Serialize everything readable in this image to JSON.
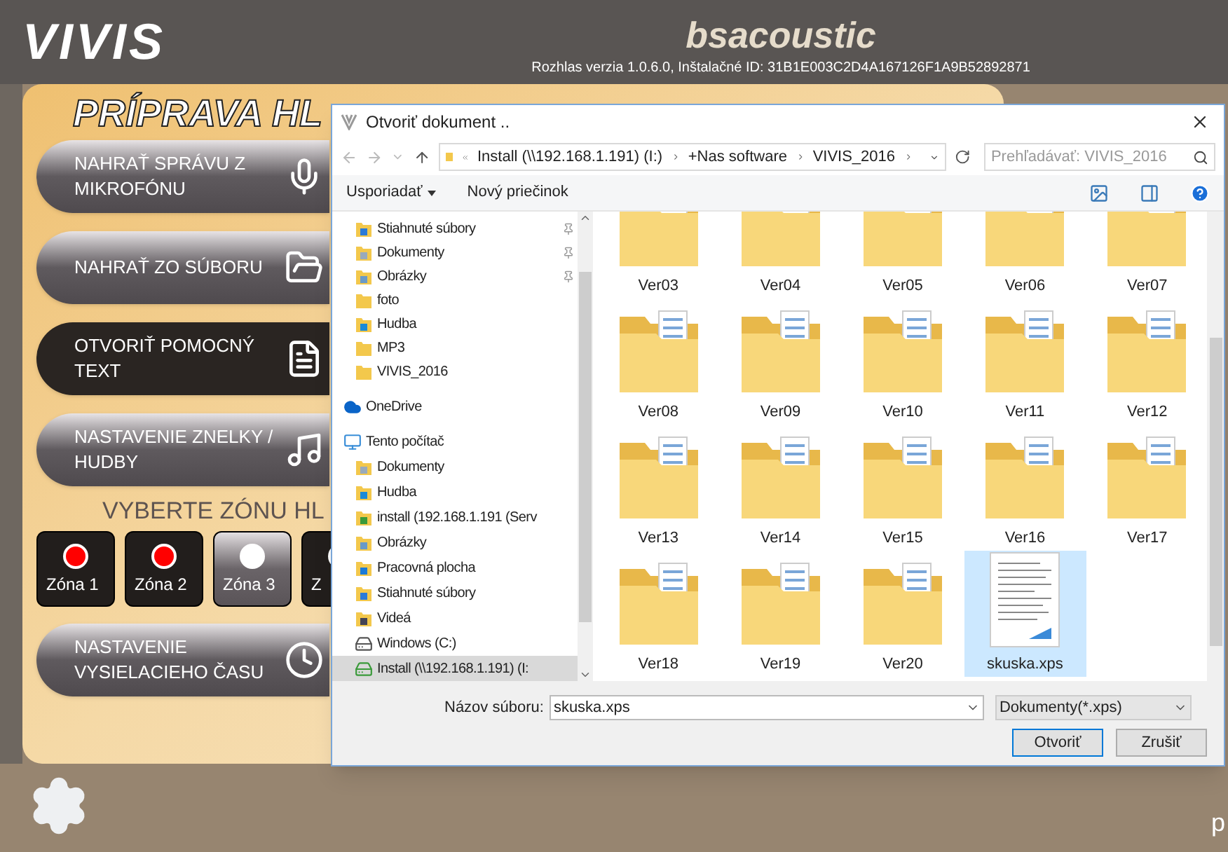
{
  "header": {
    "logo": "VIVIS",
    "brand": "bsacoustic",
    "version": "Rozhlas verzia 1.0.6.0, Inštalačné ID: 31B1E003C2D4A167126F1A9B52892871"
  },
  "panel": {
    "title": "PRÍPRAVA HL",
    "actions": [
      {
        "label": "NAHRAŤ SPRÁVU Z MIKROFÓNU",
        "kind": "mic",
        "selected": false
      },
      {
        "label": "NAHRAŤ ZO SÚBORU",
        "kind": "folder-music",
        "selected": false
      },
      {
        "label": "OTVORIŤ POMOCNÝ TEXT",
        "kind": "text",
        "selected": true
      },
      {
        "label": "NASTAVENIE ZNELKY / HUDBY",
        "kind": "music",
        "selected": false
      }
    ],
    "zone_heading": "VYBERTE ZÓNU HL",
    "zones": [
      {
        "label": "Zóna 1",
        "selected": false
      },
      {
        "label": "Zóna 2",
        "selected": false
      },
      {
        "label": "Zóna 3",
        "selected": true
      },
      {
        "label": "Z",
        "selected": false
      }
    ],
    "time_button": {
      "label": "NASTAVENIE VYSIELACIEHO ČASU",
      "kind": "clock",
      "selected": false
    }
  },
  "corner_text": "p",
  "dialog": {
    "title": "Otvoriť dokument ..",
    "path": [
      "Install (\\\\192.168.1.191) (I:)",
      "+Nas software",
      "VIVIS_2016"
    ],
    "search": {
      "placeholder": "Prehľadávať: VIVIS_2016"
    },
    "commands": [
      "Usporiadať",
      "Nový priečinok"
    ],
    "quick_access": [
      {
        "label": "Stiahnuté súbory",
        "kind": "download",
        "pinned": true
      },
      {
        "label": "Dokumenty",
        "kind": "document",
        "pinned": true
      },
      {
        "label": "Obrázky",
        "kind": "pictures",
        "pinned": true
      },
      {
        "label": "foto",
        "kind": "folder",
        "pinned": false
      },
      {
        "label": "Hudba",
        "kind": "music",
        "pinned": false
      },
      {
        "label": "MP3",
        "kind": "folder",
        "pinned": false
      },
      {
        "label": "VIVIS_2016",
        "kind": "folder",
        "pinned": false
      }
    ],
    "locations": [
      {
        "label": "OneDrive",
        "kind": "cloud",
        "selected": false
      },
      {
        "label": "Tento počítač",
        "kind": "computer",
        "selected": false,
        "children": [
          {
            "label": "Dokumenty",
            "kind": "document",
            "selected": false
          },
          {
            "label": "Hudba",
            "kind": "music",
            "selected": false
          },
          {
            "label": "install (192.168.1.191 (Serv",
            "kind": "network",
            "selected": false
          },
          {
            "label": "Obrázky",
            "kind": "pictures",
            "selected": false
          },
          {
            "label": "Pracovná plocha",
            "kind": "desktop",
            "selected": false
          },
          {
            "label": "Stiahnuté súbory",
            "kind": "download",
            "selected": false
          },
          {
            "label": "Videá",
            "kind": "video",
            "selected": false
          },
          {
            "label": "Windows (C:)",
            "kind": "drive",
            "selected": false
          },
          {
            "label": "Install (\\\\192.168.1.191) (I:",
            "kind": "netdrive",
            "selected": true
          }
        ]
      }
    ],
    "files": [
      {
        "name": "Ver03",
        "kind": "folder",
        "selected": false
      },
      {
        "name": "Ver04",
        "kind": "folder",
        "selected": false
      },
      {
        "name": "Ver05",
        "kind": "folder",
        "selected": false
      },
      {
        "name": "Ver06",
        "kind": "folder",
        "selected": false
      },
      {
        "name": "Ver07",
        "kind": "folder",
        "selected": false
      },
      {
        "name": "Ver08",
        "kind": "folder",
        "selected": false
      },
      {
        "name": "Ver09",
        "kind": "folder",
        "selected": false
      },
      {
        "name": "Ver10",
        "kind": "folder",
        "selected": false
      },
      {
        "name": "Ver11",
        "kind": "folder",
        "selected": false
      },
      {
        "name": "Ver12",
        "kind": "folder",
        "selected": false
      },
      {
        "name": "Ver13",
        "kind": "folder",
        "selected": false
      },
      {
        "name": "Ver14",
        "kind": "folder",
        "selected": false
      },
      {
        "name": "Ver15",
        "kind": "folder",
        "selected": false
      },
      {
        "name": "Ver16",
        "kind": "folder",
        "selected": false
      },
      {
        "name": "Ver17",
        "kind": "folder",
        "selected": false
      },
      {
        "name": "Ver18",
        "kind": "folder",
        "selected": false
      },
      {
        "name": "Ver19",
        "kind": "folder",
        "selected": false
      },
      {
        "name": "Ver20",
        "kind": "folder",
        "selected": false
      },
      {
        "name": "skuska.xps",
        "kind": "document",
        "selected": true
      }
    ],
    "filename_label": "Názov súboru:",
    "filename": "skuska.xps",
    "filetype": "Dokumenty(*.xps)",
    "buttons": [
      {
        "label": "Otvoriť",
        "selected": true
      },
      {
        "label": "Zrušiť",
        "selected": false
      }
    ]
  }
}
